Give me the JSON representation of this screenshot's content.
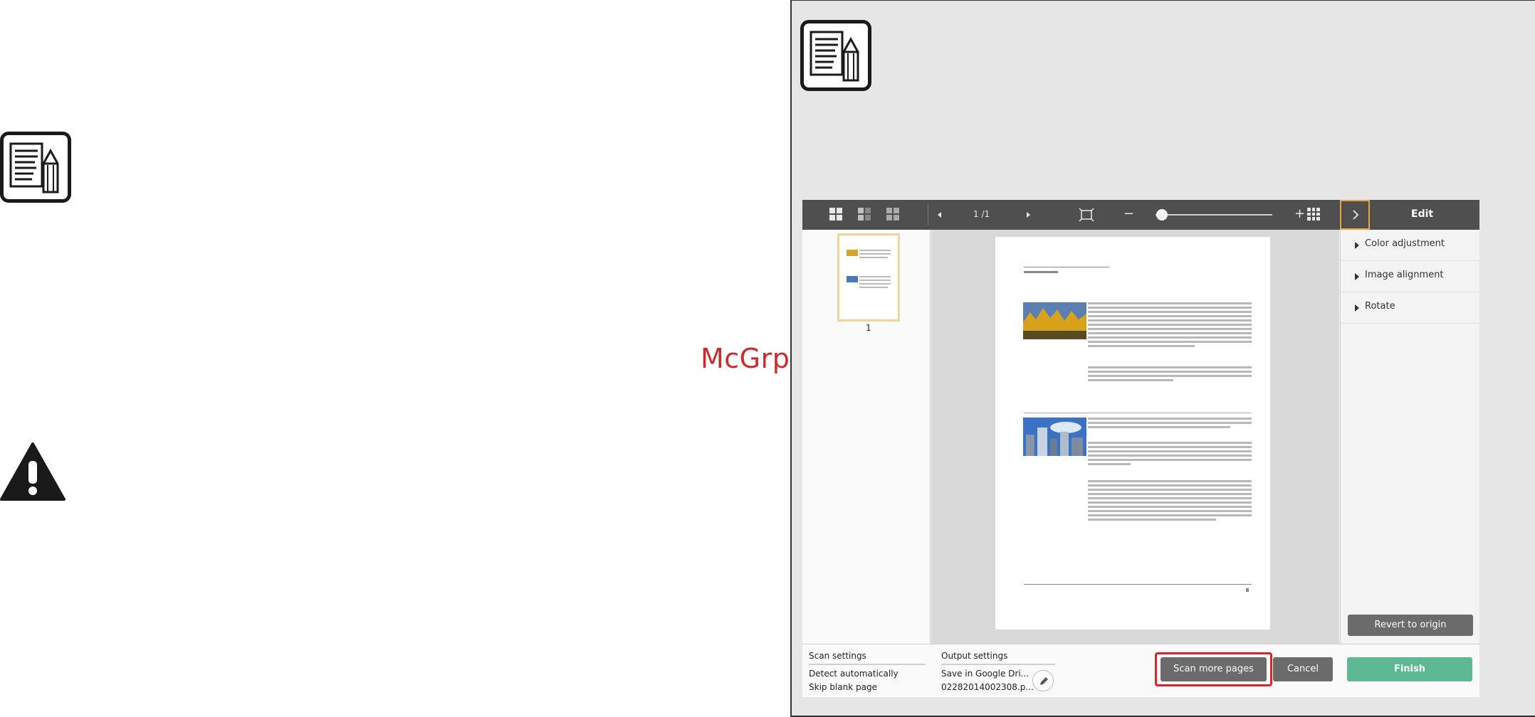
{
  "watermark": "McGrp.Ru",
  "toolbar": {
    "page_indicator": "1 /1",
    "zoom_minus": "−",
    "zoom_plus": "+",
    "edit_title": "Edit"
  },
  "thumbnail": {
    "page_number": "1"
  },
  "edit_panel": {
    "items": [
      "Color adjustment",
      "Image alignment",
      "Rotate"
    ],
    "revert_label": "Revert to origin"
  },
  "scan_settings": {
    "title": "Scan settings",
    "line1": "Detect automatically",
    "line2": "Skip blank page"
  },
  "output_settings": {
    "title": "Output settings",
    "line1": "Save in Google Dri...",
    "line2": "02282014002308.p..."
  },
  "buttons": {
    "scan_more": "Scan more pages",
    "cancel": "Cancel",
    "finish": "Finish"
  },
  "colors": {
    "toolbar": "#4f4f4f",
    "finish": "#5fb894",
    "highlight": "#e0202a",
    "accent": "#e3a73a"
  }
}
